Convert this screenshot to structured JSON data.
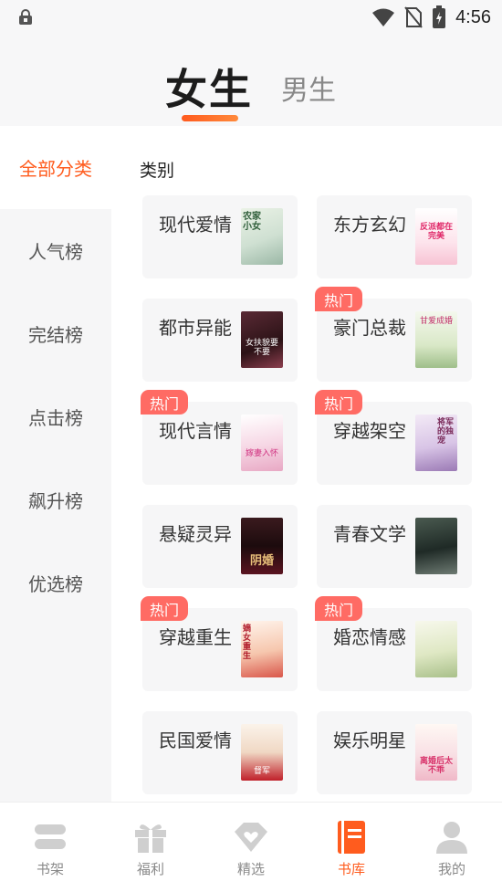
{
  "status_bar": {
    "time": "4:56"
  },
  "header": {
    "tabs": [
      "女生",
      "男生"
    ],
    "active_tab": "女生"
  },
  "sidebar": {
    "items": [
      "全部分类",
      "人气榜",
      "完结榜",
      "点击榜",
      "飙升榜",
      "优选榜"
    ],
    "active": "全部分类"
  },
  "main": {
    "section_title": "类别",
    "hot_label": "热门",
    "categories": [
      {
        "name": "现代爱情",
        "hot": false,
        "cover_text": "农家小女"
      },
      {
        "name": "东方玄幻",
        "hot": false,
        "cover_text": "反派都在完美"
      },
      {
        "name": "都市异能",
        "hot": false,
        "cover_text": "女扶貌要不要"
      },
      {
        "name": "豪门总裁",
        "hot": true,
        "cover_text": "甘爱成婚"
      },
      {
        "name": "现代言情",
        "hot": true,
        "cover_text": "嫁妻入怀"
      },
      {
        "name": "穿越架空",
        "hot": true,
        "cover_text": "将军的独宠"
      },
      {
        "name": "悬疑灵异",
        "hot": false,
        "cover_text": "阴婚"
      },
      {
        "name": "青春文学",
        "hot": false,
        "cover_text": ""
      },
      {
        "name": "穿越重生",
        "hot": true,
        "cover_text": "嫡女重生"
      },
      {
        "name": "婚恋情感",
        "hot": true,
        "cover_text": ""
      },
      {
        "name": "民国爱情",
        "hot": false,
        "cover_text": "督军"
      },
      {
        "name": "娱乐明星",
        "hot": false,
        "cover_text": "离婚后太不乖"
      }
    ]
  },
  "bottom_nav": {
    "items": [
      {
        "label": "书架",
        "icon": "bookshelf-icon"
      },
      {
        "label": "福利",
        "icon": "gift-icon"
      },
      {
        "label": "精选",
        "icon": "diamond-heart-icon"
      },
      {
        "label": "书库",
        "icon": "library-icon"
      },
      {
        "label": "我的",
        "icon": "profile-icon"
      }
    ],
    "active": "书库"
  },
  "colors": {
    "accent": "#ff5c1e",
    "hot_badge": "#ff6b64"
  }
}
